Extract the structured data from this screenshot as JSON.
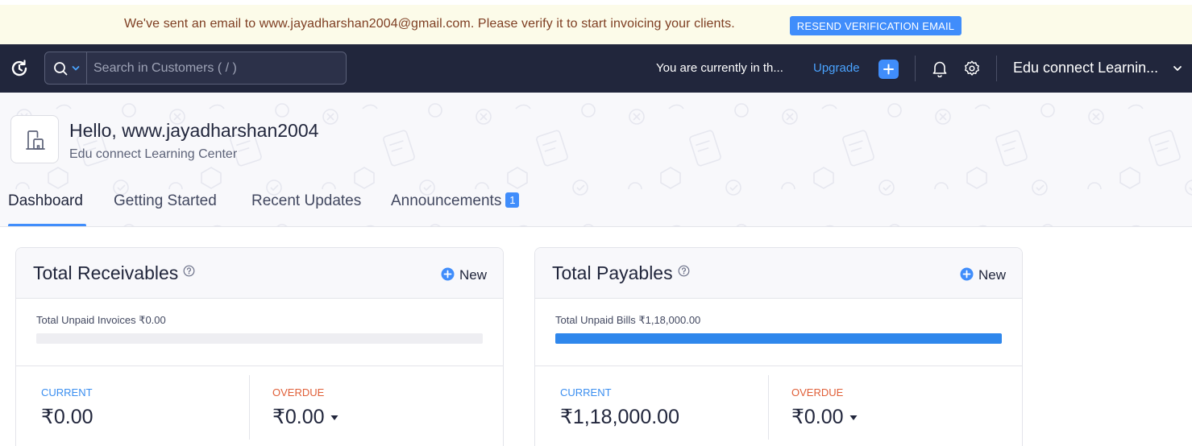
{
  "banner": {
    "message": "We've sent an email to www.jayadharshan2004@gmail.com. Please verify it to start invoicing your clients.",
    "button_label": "RESEND VERIFICATION EMAIL"
  },
  "topnav": {
    "search_placeholder": "Search in Customers ( / )",
    "trial_text": "You are currently in th...",
    "upgrade_label": "Upgrade",
    "org_name": "Edu connect Learnin..."
  },
  "header": {
    "greeting": "Hello, www.jayadharshan2004",
    "org_full_name": "Edu connect Learning Center",
    "tabs": [
      {
        "label": "Dashboard",
        "active": true
      },
      {
        "label": "Getting Started"
      },
      {
        "label": "Recent Updates"
      },
      {
        "label": "Announcements",
        "badge": "1"
      }
    ]
  },
  "colors": {
    "accent": "#408dfb",
    "nav_bg": "#21263c",
    "banner_bg": "#fcfbe9",
    "current_label": "#3a8ef0",
    "overdue_label": "#e05f38"
  },
  "cards": [
    {
      "title": "Total Receivables",
      "new_label": "New",
      "unpaid_label": "Total Unpaid Invoices ₹0.00",
      "progress_fraction": 0,
      "current_label": "CURRENT",
      "current_value": "₹0.00",
      "overdue_label": "OVERDUE",
      "overdue_value": "₹0.00"
    },
    {
      "title": "Total Payables",
      "new_label": "New",
      "unpaid_label": "Total Unpaid Bills ₹1,18,000.00",
      "progress_fraction": 1,
      "current_label": "CURRENT",
      "current_value": "₹1,18,000.00",
      "overdue_label": "OVERDUE",
      "overdue_value": "₹0.00"
    }
  ],
  "icons": [
    "refresh-logo-icon",
    "search-icon",
    "chevron-down-icon",
    "plus-icon",
    "bell-icon",
    "gear-icon",
    "building-icon",
    "help-icon",
    "add-circle-icon",
    "caret-down-icon"
  ]
}
